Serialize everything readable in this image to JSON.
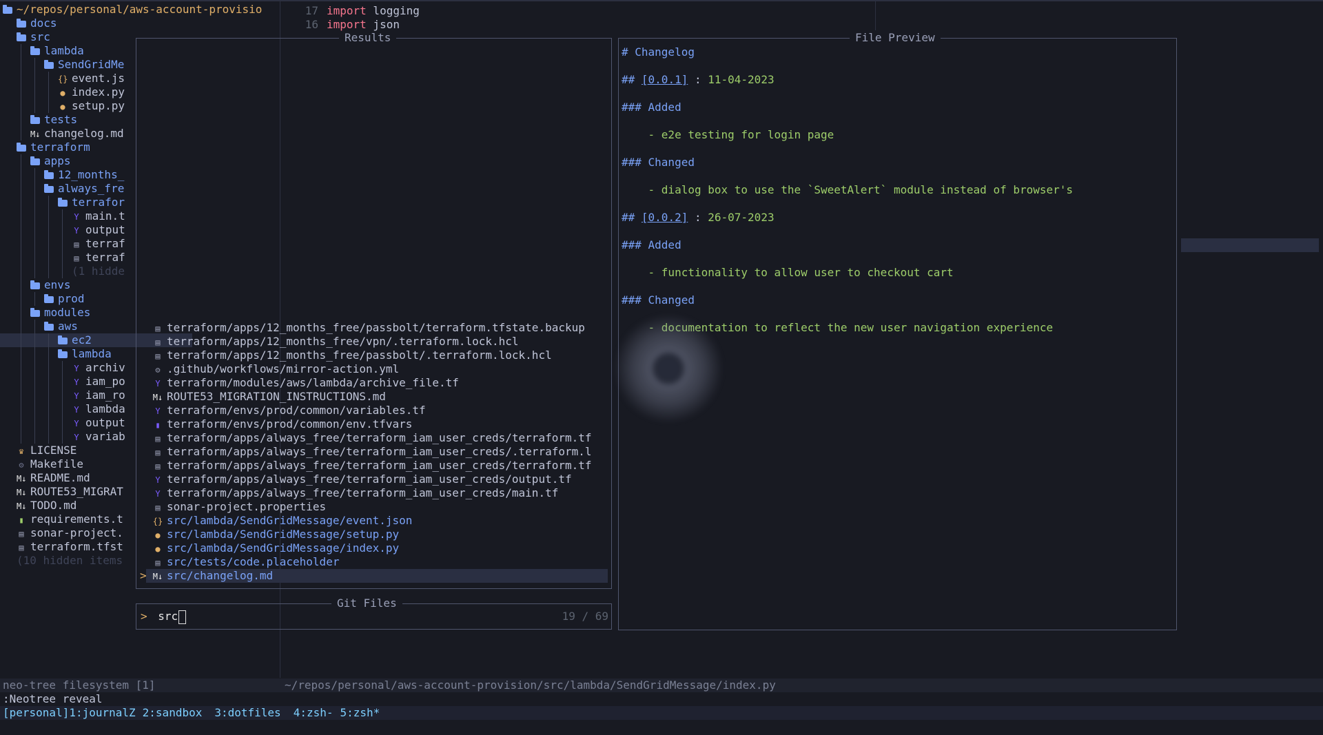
{
  "sidebar": {
    "rows": [
      {
        "depth": 0,
        "type": "dir",
        "name": "~/repos/personal/aws-account-provisio",
        "root": true
      },
      {
        "depth": 1,
        "type": "dir",
        "name": "docs"
      },
      {
        "depth": 1,
        "type": "dir",
        "name": "src"
      },
      {
        "depth": 2,
        "type": "dir",
        "name": "lambda"
      },
      {
        "depth": 3,
        "type": "dir",
        "name": "SendGridMe"
      },
      {
        "depth": 4,
        "type": "json",
        "name": "event.js"
      },
      {
        "depth": 4,
        "type": "py",
        "name": "index.py"
      },
      {
        "depth": 4,
        "type": "py",
        "name": "setup.py"
      },
      {
        "depth": 2,
        "type": "dir",
        "name": "tests"
      },
      {
        "depth": 2,
        "type": "md",
        "name": "changelog.md"
      },
      {
        "depth": 1,
        "type": "dir",
        "name": "terraform"
      },
      {
        "depth": 2,
        "type": "dir",
        "name": "apps"
      },
      {
        "depth": 3,
        "type": "dir",
        "name": "12_months_"
      },
      {
        "depth": 3,
        "type": "dir",
        "name": "always_fre"
      },
      {
        "depth": 4,
        "type": "dir",
        "name": "terrafor"
      },
      {
        "depth": 5,
        "type": "tf",
        "name": "main.t"
      },
      {
        "depth": 5,
        "type": "tf",
        "name": "output"
      },
      {
        "depth": 5,
        "type": "file",
        "name": "terraf"
      },
      {
        "depth": 5,
        "type": "file",
        "name": "terraf"
      },
      {
        "depth": 5,
        "type": "hidden",
        "name": "(1 hidde"
      },
      {
        "depth": 2,
        "type": "dir",
        "name": "envs"
      },
      {
        "depth": 3,
        "type": "dir",
        "name": "prod"
      },
      {
        "depth": 2,
        "type": "dir",
        "name": "modules"
      },
      {
        "depth": 3,
        "type": "dir",
        "name": "aws"
      },
      {
        "depth": 4,
        "type": "dir",
        "name": "ec2",
        "selected": true
      },
      {
        "depth": 4,
        "type": "dir",
        "name": "lambda"
      },
      {
        "depth": 5,
        "type": "tf",
        "name": "archiv"
      },
      {
        "depth": 5,
        "type": "tf",
        "name": "iam_po"
      },
      {
        "depth": 5,
        "type": "tf",
        "name": "iam_ro"
      },
      {
        "depth": 5,
        "type": "tf",
        "name": "lambda"
      },
      {
        "depth": 5,
        "type": "tf",
        "name": "output"
      },
      {
        "depth": 5,
        "type": "tf",
        "name": "variab"
      },
      {
        "depth": 1,
        "type": "license",
        "name": "LICENSE"
      },
      {
        "depth": 1,
        "type": "make",
        "name": "Makefile"
      },
      {
        "depth": 1,
        "type": "md",
        "name": "README.md"
      },
      {
        "depth": 1,
        "type": "md",
        "name": "ROUTE53_MIGRAT"
      },
      {
        "depth": 1,
        "type": "md",
        "name": "TODO.md"
      },
      {
        "depth": 1,
        "type": "txt",
        "name": "requirements.t"
      },
      {
        "depth": 1,
        "type": "file",
        "name": "sonar-project."
      },
      {
        "depth": 1,
        "type": "file",
        "name": "terraform.tfst"
      },
      {
        "depth": 1,
        "type": "hidden",
        "name": "(10 hidden items"
      }
    ]
  },
  "editor": {
    "lines": [
      {
        "num": "17",
        "kw": "import",
        "rest": " logging"
      },
      {
        "num": "16",
        "kw": "import",
        "rest": " json"
      }
    ]
  },
  "telescope": {
    "results_title": "Results",
    "prompt_title": "Git Files",
    "preview_title": "File Preview",
    "prompt_symbol": ">",
    "query": "src",
    "counter": "19 / 69",
    "selected_marker": ">",
    "results": [
      {
        "icon": "file",
        "path": "terraform/apps/12_months_free/passbolt/terraform.tfstate.backup"
      },
      {
        "icon": "file",
        "path": "terraform/apps/12_months_free/vpn/.terraform.lock.hcl"
      },
      {
        "icon": "file",
        "path": "terraform/apps/12_months_free/passbolt/.terraform.lock.hcl"
      },
      {
        "icon": "gear",
        "path": ".github/workflows/mirror-action.yml"
      },
      {
        "icon": "tf",
        "path": "terraform/modules/aws/lambda/archive_file.tf"
      },
      {
        "icon": "md",
        "path": "ROUTE53_MIGRATION_INSTRUCTIONS.md"
      },
      {
        "icon": "tf",
        "path": "terraform/envs/prod/common/variables.tf"
      },
      {
        "icon": "vars",
        "path": "terraform/envs/prod/common/env.tfvars"
      },
      {
        "icon": "file",
        "path": "terraform/apps/always_free/terraform_iam_user_creds/terraform.tf"
      },
      {
        "icon": "file",
        "path": "terraform/apps/always_free/terraform_iam_user_creds/.terraform.l"
      },
      {
        "icon": "file",
        "path": "terraform/apps/always_free/terraform_iam_user_creds/terraform.tf"
      },
      {
        "icon": "tf",
        "path": "terraform/apps/always_free/terraform_iam_user_creds/output.tf"
      },
      {
        "icon": "tf",
        "path": "terraform/apps/always_free/terraform_iam_user_creds/main.tf"
      },
      {
        "icon": "file",
        "path": "sonar-project.properties"
      },
      {
        "icon": "json",
        "path": "src/lambda/SendGridMessage/event.json",
        "blue": true
      },
      {
        "icon": "py",
        "path": "src/lambda/SendGridMessage/setup.py",
        "blue": true
      },
      {
        "icon": "py",
        "path": "src/lambda/SendGridMessage/index.py",
        "blue": true
      },
      {
        "icon": "file",
        "path": "src/tests/code.placeholder",
        "blue": true
      },
      {
        "icon": "md",
        "path": "src/changelog.md",
        "blue": true,
        "selected": true
      }
    ],
    "preview": [
      {
        "kind": "h",
        "parts": [
          [
            "md-h",
            "# Changelog"
          ]
        ]
      },
      {
        "kind": "h2",
        "parts": [
          [
            "md-h",
            "## "
          ],
          [
            "md-link",
            "[0.0.1]"
          ],
          [
            "md-text",
            " : "
          ],
          [
            "md-date",
            "11-04-2023"
          ]
        ]
      },
      {
        "kind": "h3",
        "parts": [
          [
            "md-h",
            "### Added"
          ]
        ]
      },
      {
        "kind": "li",
        "parts": [
          [
            "md-item",
            "    - e2e testing for login page"
          ]
        ]
      },
      {
        "kind": "h3",
        "parts": [
          [
            "md-h",
            "### Changed"
          ]
        ]
      },
      {
        "kind": "li",
        "parts": [
          [
            "md-item",
            "    - dialog box to use the `SweetAlert` module instead of browser's"
          ]
        ]
      },
      {
        "kind": "h2",
        "parts": [
          [
            "md-h",
            "## "
          ],
          [
            "md-link",
            "[0.0.2]"
          ],
          [
            "md-text",
            " : "
          ],
          [
            "md-date",
            "26-07-2023"
          ]
        ]
      },
      {
        "kind": "h3",
        "parts": [
          [
            "md-h",
            "### Added"
          ]
        ]
      },
      {
        "kind": "li",
        "parts": [
          [
            "md-item",
            "    - functionality to allow user to checkout cart"
          ]
        ]
      },
      {
        "kind": "h3",
        "parts": [
          [
            "md-h",
            "### Changed"
          ]
        ]
      },
      {
        "kind": "li",
        "parts": [
          [
            "md-item",
            "    - documentation to reflect the new user navigation experience"
          ]
        ]
      }
    ]
  },
  "statusline": {
    "left": "neo-tree filesystem [1]",
    "right": "~/repos/personal/aws-account-provision/src/lambda/SendGridMessage/index.py"
  },
  "cmdline": ":Neotree reveal",
  "tmux": {
    "session": "[personal]",
    "windows": [
      "1:journalZ",
      "2:sandbox",
      "3:dotfiles",
      "4:zsh-",
      "5:zsh*"
    ]
  },
  "colors": {
    "background": "#181a22",
    "accent_blue": "#7aa2f7",
    "accent_green": "#9ece6a",
    "accent_red": "#f7768e",
    "accent_yellow": "#e0af68",
    "terraform_purple": "#7b5cff"
  }
}
